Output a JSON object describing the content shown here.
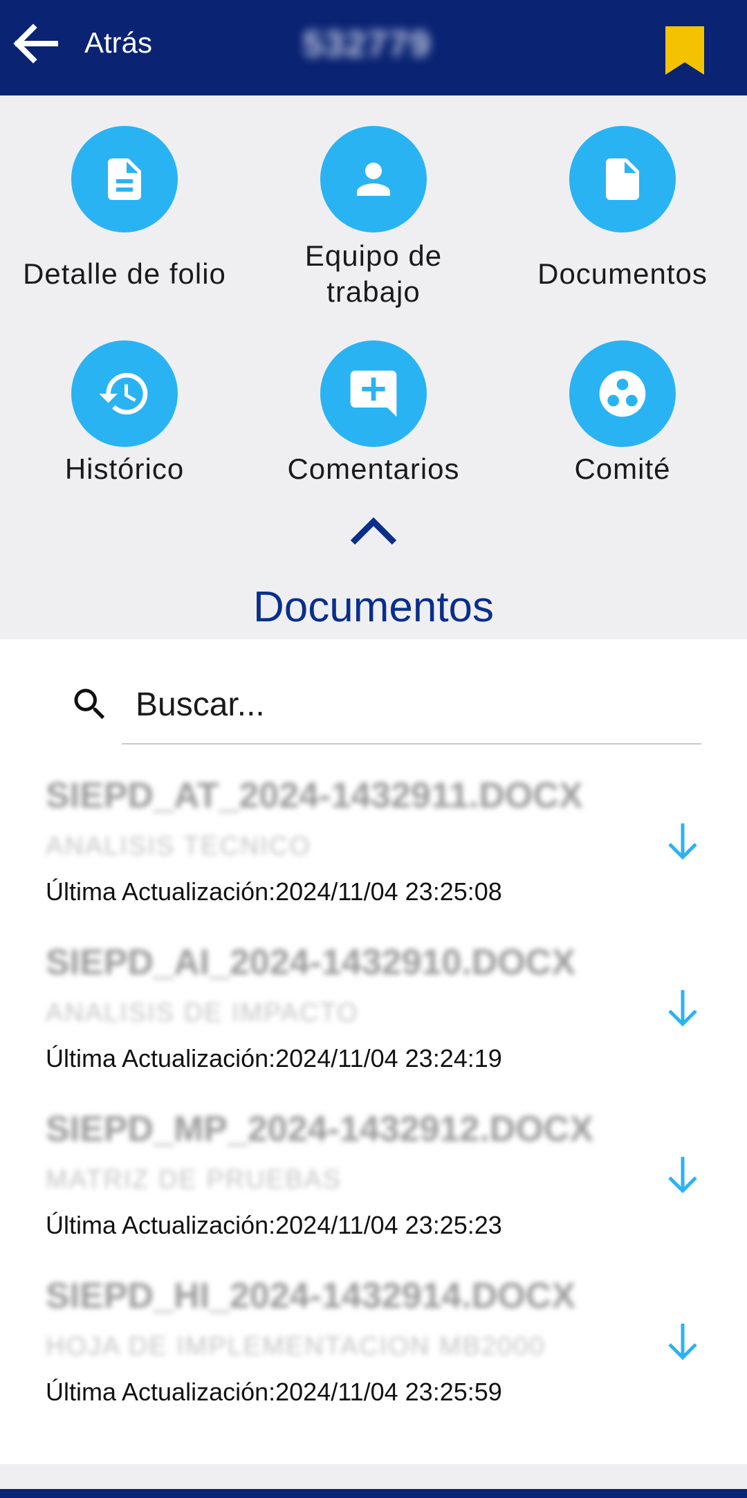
{
  "header": {
    "back_label": "Atrás",
    "folio_id": "532779"
  },
  "menu": {
    "items": [
      {
        "label": "Detalle de folio",
        "icon": "document-lines-icon"
      },
      {
        "label": "Equipo de trabajo",
        "icon": "person-icon"
      },
      {
        "label": "Documentos",
        "icon": "file-icon"
      },
      {
        "label": "Histórico",
        "icon": "history-icon"
      },
      {
        "label": "Comentarios",
        "icon": "add-comment-icon"
      },
      {
        "label": "Comité",
        "icon": "group-circles-icon"
      }
    ]
  },
  "section": {
    "title": "Documentos"
  },
  "search": {
    "placeholder": "Buscar..."
  },
  "documents": [
    {
      "name": "SIEPD_AT_2024-1432911.DOCX",
      "type": "ANALISIS TECNICO",
      "updated": "Última Actualización:2024/11/04 23:25:08"
    },
    {
      "name": "SIEPD_AI_2024-1432910.DOCX",
      "type": "ANALISIS DE IMPACTO",
      "updated": "Última Actualización:2024/11/04 23:24:19"
    },
    {
      "name": "SIEPD_MP_2024-1432912.DOCX",
      "type": "MATRIZ DE PRUEBAS",
      "updated": "Última Actualización:2024/11/04 23:25:23"
    },
    {
      "name": "SIEPD_HI_2024-1432914.DOCX",
      "type": "HOJA DE IMPLEMENTACION MB2000",
      "updated": "Última Actualización:2024/11/04 23:25:59"
    }
  ],
  "colors": {
    "header": "#0a2373",
    "accent": "#29b3f3",
    "bookmark": "#f5c200",
    "title": "#0a2f8a"
  }
}
